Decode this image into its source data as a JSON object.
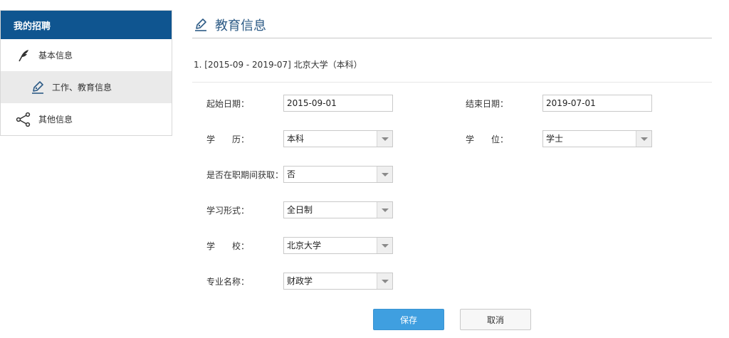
{
  "sidebar": {
    "header": "我的招聘",
    "items": [
      {
        "label": "基本信息",
        "icon": "feather-icon"
      },
      {
        "label": "工作、教育信息",
        "icon": "edit-icon"
      },
      {
        "label": "其他信息",
        "icon": "share-icon"
      }
    ]
  },
  "main": {
    "title": "教育信息",
    "record_title": "1. [2015-09 - 2019-07] 北京大学（本科）",
    "fields": {
      "start_date": {
        "label": "起始日期：",
        "value": "2015-09-01"
      },
      "end_date": {
        "label": "结束日期：",
        "value": "2019-07-01"
      },
      "education": {
        "label": "学　　历：",
        "value": "本科"
      },
      "degree": {
        "label": "学　　位：",
        "value": "学士"
      },
      "during_employment": {
        "label": "是否在职期间获取：",
        "value": "否"
      },
      "study_form": {
        "label": "学习形式：",
        "value": "全日制"
      },
      "school": {
        "label": "学　　校：",
        "value": "北京大学"
      },
      "major": {
        "label": "专业名称：",
        "value": "财政学"
      }
    },
    "buttons": {
      "save": "保存",
      "cancel": "取消"
    }
  },
  "colors": {
    "header_blue": "#0f5590",
    "title_blue": "#2d5b86",
    "save_blue": "#3f9fe0",
    "active_item_bg": "#eaeaea"
  }
}
